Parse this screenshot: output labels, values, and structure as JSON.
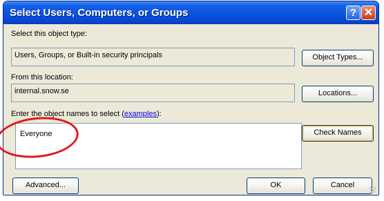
{
  "window": {
    "title": "Select Users, Computers, or Groups",
    "help_button": "?",
    "close_button": "✕"
  },
  "object_type": {
    "label": "Select this object type:",
    "value": "Users, Groups, or Built-in security principals",
    "button": "Object Types..."
  },
  "location": {
    "label": "From this location:",
    "value": "internal.snow.se",
    "button": "Locations..."
  },
  "names": {
    "label_prefix": "Enter the object names to select (",
    "label_link": "examples",
    "label_suffix": "):",
    "value": "Everyone",
    "check_button": "Check Names"
  },
  "footer": {
    "advanced_button": "Advanced...",
    "ok_button": "OK",
    "cancel_button": "Cancel"
  },
  "colors": {
    "title_bar": "#0a52de",
    "dialog_bg": "#ece9d8",
    "annotation_ring": "#e3161d"
  }
}
